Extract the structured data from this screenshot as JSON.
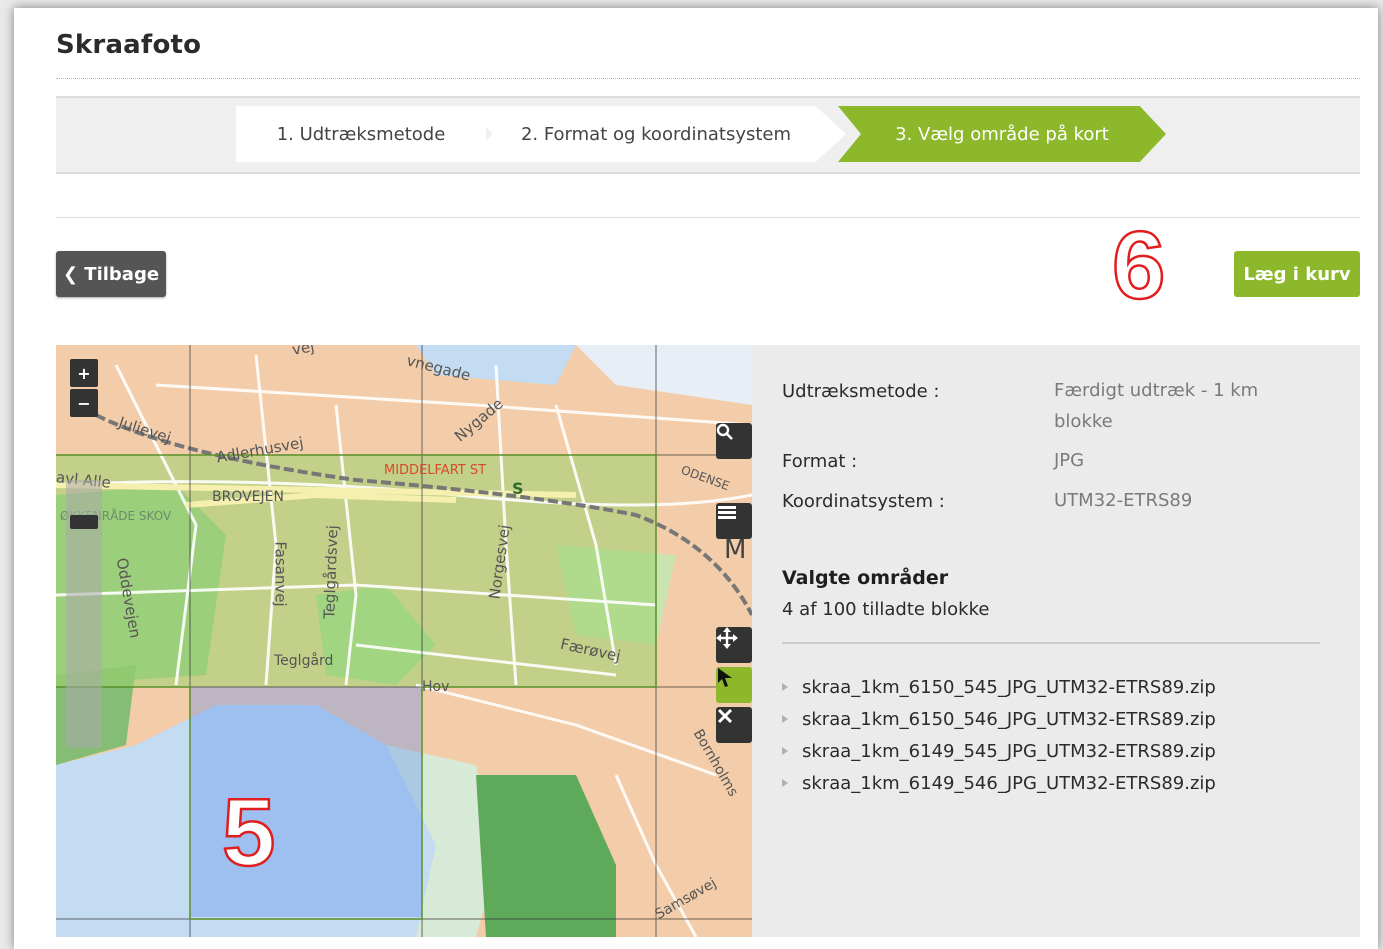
{
  "page": {
    "title": "Skraafoto"
  },
  "steps": [
    {
      "label": "1. Udtræksmetode",
      "active": false
    },
    {
      "label": "2. Format og koordinatsystem",
      "active": false
    },
    {
      "label": "3. Vælg område på kort",
      "active": true
    }
  ],
  "buttons": {
    "back": "❮ Tilbage",
    "cart": "Læg i kurv"
  },
  "annotations": {
    "cart_marker": "6",
    "map_marker": "5"
  },
  "map": {
    "zoom_in": "+",
    "zoom_out": "−",
    "labels": {
      "adlerhusvej": "Adlerhusvej",
      "julievej": "Julievej",
      "avl_alle": "avl Alle",
      "brovejen": "BROVEJEN",
      "skov": "ØKKENRÅDE SKOV",
      "middelfart_st": "MIDDELFART ST",
      "fasanvej": "Fasanvej",
      "teglgaardsvej": "Teglgårdsvej",
      "norgesvej": "Norgesvej",
      "faeroevej": "Færøvej",
      "oddevejen": "Oddevejen",
      "teglgaard": "Teglgård",
      "hov": "Hov",
      "nygade": "Nygade",
      "havnegade": "vnegade",
      "odense": "ODENSE",
      "bornholmsvej": "Bornholms",
      "samsoevej": "Samsøvej",
      "station": "S",
      "vej_top": "vej",
      "m": "M"
    },
    "tools": [
      "search-icon",
      "layers-icon",
      "pan-icon",
      "select-icon",
      "clear-icon"
    ],
    "selected_blocks_highlight": "#8db82b"
  },
  "info": {
    "method_label": "Udtræksmetode :",
    "method_value": "Færdigt udtræk - 1 km blokke",
    "format_label": "Format :",
    "format_value": "JPG",
    "crs_label": "Koordinatsystem :",
    "crs_value": "UTM32-ETRS89",
    "selected_title": "Valgte områder",
    "selected_count": "4 af 100 tilladte blokke",
    "files": [
      "skraa_1km_6150_545_JPG_UTM32-ETRS89.zip",
      "skraa_1km_6150_546_JPG_UTM32-ETRS89.zip",
      "skraa_1km_6149_545_JPG_UTM32-ETRS89.zip",
      "skraa_1km_6149_546_JPG_UTM32-ETRS89.zip"
    ]
  },
  "colors": {
    "accent": "#8db82b",
    "dark_button": "#555555",
    "annotation": "#e01e1e"
  }
}
